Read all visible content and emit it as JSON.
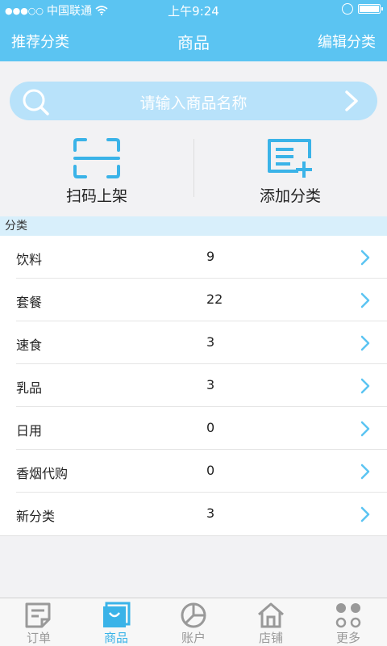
{
  "status_bar": {
    "signal": "●●●○○",
    "carrier": "中国联通",
    "time": "上午9:24"
  },
  "nav": {
    "left_label": "推荐分类",
    "title": "商品",
    "right_label": "编辑分类"
  },
  "search": {
    "placeholder": "请输入商品名称"
  },
  "actions": {
    "scan_label": "扫码上架",
    "add_label": "添加分类"
  },
  "section": {
    "title": "分类"
  },
  "categories": [
    {
      "name": "饮料",
      "count": "9"
    },
    {
      "name": "套餐",
      "count": "22"
    },
    {
      "name": "速食",
      "count": "3"
    },
    {
      "name": "乳品",
      "count": "3"
    },
    {
      "name": "日用",
      "count": "0"
    },
    {
      "name": "香烟代购",
      "count": "0"
    },
    {
      "name": "新分类",
      "count": "3"
    }
  ],
  "tabs": [
    {
      "label": "订单",
      "icon": "order-icon"
    },
    {
      "label": "商品",
      "icon": "goods-icon"
    },
    {
      "label": "账户",
      "icon": "account-icon"
    },
    {
      "label": "店铺",
      "icon": "shop-icon"
    },
    {
      "label": "更多",
      "icon": "more-icon"
    }
  ],
  "colors": {
    "header": "#5bc4f2",
    "accent": "#3ab3e8",
    "search_bg": "#b8e2fa",
    "section_bg": "#d8effb",
    "tab_inactive": "#999999"
  }
}
